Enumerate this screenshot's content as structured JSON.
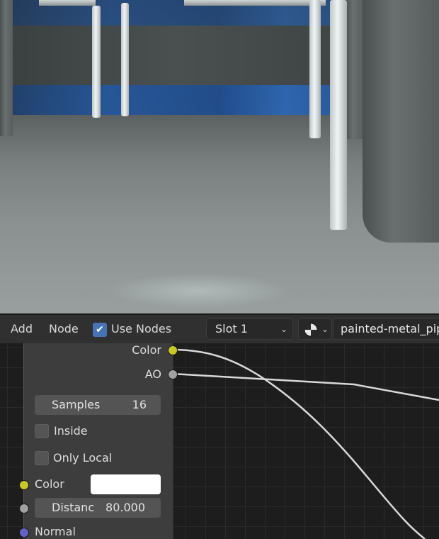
{
  "toolbar": {
    "add_label": "Add",
    "node_label": "Node",
    "use_nodes_label": "Use Nodes",
    "use_nodes_checked": true,
    "slot_value": "Slot 1",
    "material_name": "painted-metal_pip"
  },
  "node": {
    "outputs": [
      {
        "label": "Color",
        "socket_color": "#c7c729"
      },
      {
        "label": "AO",
        "socket_color": "#a1a1a1"
      }
    ],
    "samples_label": "Samples",
    "samples_value": "16",
    "inside_label": "Inside",
    "only_local_label": "Only Local",
    "color_input_label": "Color",
    "color_input_value": "#ffffff",
    "distance_label": "Distanc",
    "distance_value": "80.000",
    "normal_label": "Normal",
    "normal_socket_color": "#6363c7"
  },
  "colors": {
    "accent": "#4772b3",
    "header_bg": "#303030",
    "canvas_bg": "#1d1d1d",
    "node_bg": "#3d3d3d"
  }
}
